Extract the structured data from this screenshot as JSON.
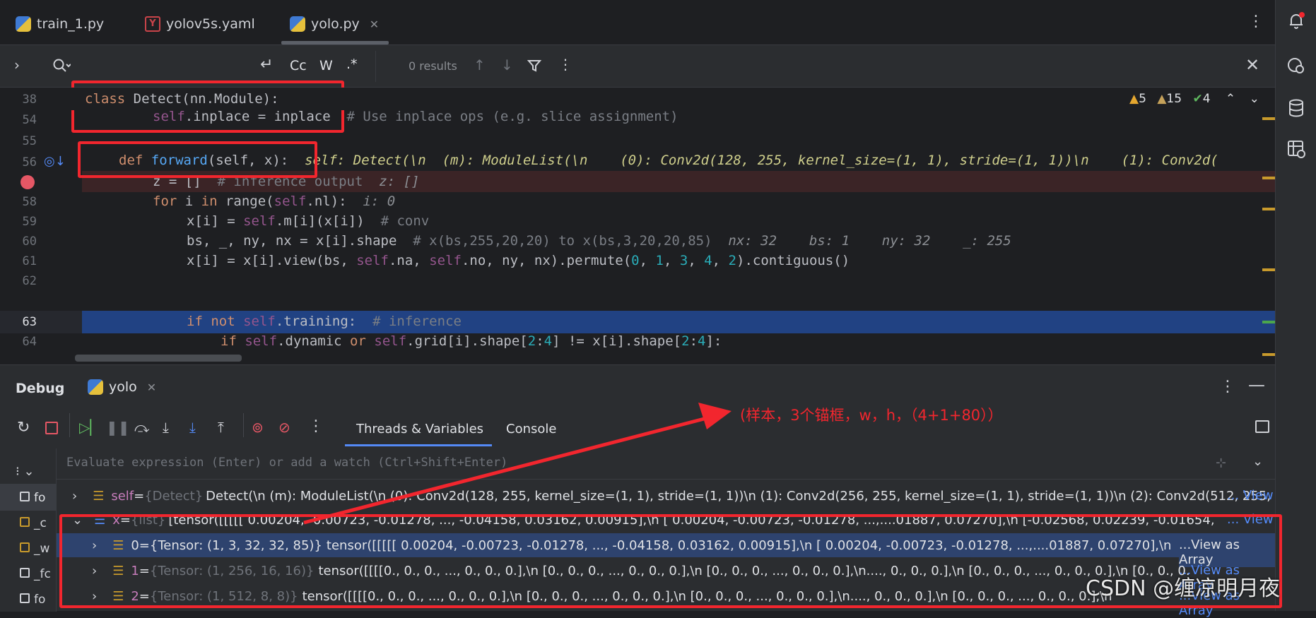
{
  "tabs": [
    {
      "label": "train_1.py",
      "icon": "python-file-icon"
    },
    {
      "label": "yolov5s.yaml",
      "icon": "yaml-file-icon"
    },
    {
      "label": "yolo.py",
      "icon": "python-file-icon",
      "close": "✕"
    }
  ],
  "find": {
    "results": "0 results",
    "case_label": "Cc",
    "word_label": "W",
    "regex_label": ".*"
  },
  "inspections": {
    "warnings": "5",
    "weak_warnings": "15",
    "typos": "4"
  },
  "code": {
    "sticky": {
      "ln": "38",
      "text": "class Detect(nn.Module):"
    },
    "lines": [
      {
        "ln": "54",
        "text": "self.inplace = inplace  # Use inplace ops (e.g. slice assignment)"
      },
      {
        "ln": "55",
        "text": ""
      },
      {
        "ln": "56",
        "def": "def ",
        "fname": "forward",
        "args": "(self, x):",
        "hint": "self: Detect(\\n  (m): ModuleList(\\n    (0): Conv2d(128, 255, kernel_size=(1, 1), stride=(1, 1))\\n    (1): Conv2d("
      },
      {
        "ln": "57",
        "text": "z = []",
        "comment": "  # inference output",
        "hint": "  z: []"
      },
      {
        "ln": "58",
        "text": "for i in range(self.nl):",
        "hint": "  i: 0"
      },
      {
        "ln": "59",
        "text": "x[i] = self.m[i](x[i])",
        "comment": "  # conv"
      },
      {
        "ln": "60",
        "text": "bs, _, ny, nx = x[i].shape",
        "comment": "  # x(bs,255,20,20) to x(bs,3,20,20,85)",
        "hint": "  nx: 32    bs: 1    ny: 32    _: 255"
      },
      {
        "ln": "61",
        "text": "x[i] = x[i].view(bs, self.na, self.no, ny, nx).permute(0, 1, 3, 4, 2).contiguous()"
      },
      {
        "ln": "62",
        "text": ""
      },
      {
        "ln": "63",
        "text": "if not self.training:",
        "comment": "  # inference"
      },
      {
        "ln": "64",
        "text": "if self.dynamic or self.grid[i].shape[2:4] != x[i].shape[2:4]:"
      }
    ]
  },
  "debug": {
    "title": "Debug",
    "session": "yolo",
    "close": "✕",
    "tabs": [
      "Threads & Variables",
      "Console"
    ],
    "eval_placeholder": "Evaluate expression (Enter) or add a watch (Ctrl+Shift+Enter)",
    "frames": [
      "fo",
      "_c",
      "_w",
      "_fc",
      "fo"
    ],
    "vars": [
      {
        "name": "self",
        "type": "{Detect}",
        "value": "Detect(\\n  (m): ModuleList(\\n    (0): Conv2d(128, 255, kernel_size=(1, 1), stride=(1, 1))\\n    (1): Conv2d(256, 255, kernel_size=(1, 1), stride=(1, 1))\\n    (2): Conv2d(512, 255, k",
        "link": "... View"
      },
      {
        "name": "x",
        "type": "{list}",
        "value": "[tensor([[[[[ 0.00204, -0.00723, -0.01278,  ..., -0.04158,  0.03162,  0.00915],\\n          [ 0.00204, -0.00723, -0.01278,  ...,....01887,  0.07270],\\n          [-0.02568,  0.02239, -0.01654,",
        "link": "... View"
      },
      {
        "name": "0",
        "type": "{Tensor: (1, 3, 32, 32, 85)}",
        "value": "tensor([[[[[ 0.00204, -0.00723, -0.01278,  ..., -0.04158,  0.03162,  0.00915],\\n          [ 0.00204, -0.00723, -0.01278,  ...,....01887,  0.07270],\\n",
        "link": "...View as Array"
      },
      {
        "name": "1",
        "type": "{Tensor: (1, 256, 16, 16)}",
        "value": "tensor([[[[0., 0., 0.,  ..., 0., 0., 0.],\\n          [0., 0., 0.,  ..., 0., 0., 0.],\\n          [0., 0., 0.,  ..., 0., 0., 0.],\\n...., 0., 0., 0.],\\n          [0., 0., 0.,  ..., 0., 0., 0.],\\n          [0., 0., 0.",
        "link": "...View as Array"
      },
      {
        "name": "2",
        "type": "{Tensor: (1, 512, 8, 8)}",
        "value": "tensor([[[[0., 0., 0.,  ..., 0., 0., 0.],\\n          [0., 0., 0.,  ..., 0., 0., 0.],\\n          [0., 0., 0.,  ..., 0., 0., 0.],\\n...., 0., 0., 0.],\\n          [0., 0., 0.,  ..., 0., 0., 0.],\\n",
        "link": "...View as Array"
      }
    ]
  },
  "annotation": {
    "text": "(样本，3个锚框，w，h，（4+1+80））",
    "color": "#f2262e"
  },
  "watermark": "CSDN @缠凉明月夜",
  "colors": {
    "highlight": "#214283",
    "breakpoint_line": "#3b2426",
    "accent": "#548af7",
    "annotation": "#f2262e"
  }
}
